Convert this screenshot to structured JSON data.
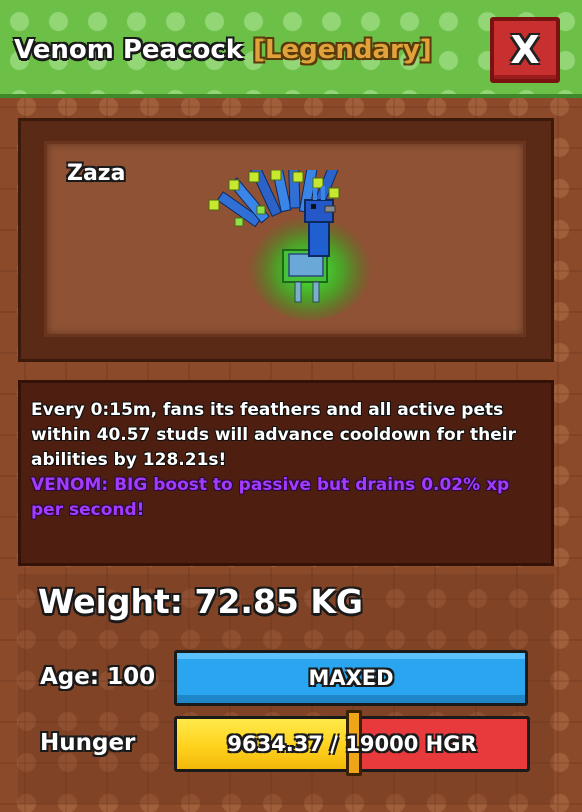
{
  "header": {
    "pet_title": "Venom Peacock",
    "rarity": "[Legendary]",
    "close_label": "X"
  },
  "preview": {
    "pet_nickname": "Zaza"
  },
  "description": {
    "ability": "Every 0:15m, fans its feathers and all active pets within 40.57 studs will advance cooldown for their abilities by 128.21s!",
    "mutation": "VENOM: BIG boost to passive but drains 0.02% xp per second!"
  },
  "stats": {
    "weight": "Weight: 72.85 KG",
    "age_label": "Age: 100",
    "age_bar_text": "MAXED",
    "hunger_label": "Hunger",
    "hunger_bar_text": "9634.37 / 19000 HGR",
    "hunger_current": 9634.37,
    "hunger_max": 19000
  },
  "colors": {
    "header_green": "#6cc048",
    "close_red": "#c7302e",
    "rarity_gold": "#e0a23a",
    "venom_purple": "#a23aff",
    "age_blue": "#2aa6f0",
    "hunger_yellow": "#ffd21e",
    "hunger_red": "#e83a3c"
  }
}
